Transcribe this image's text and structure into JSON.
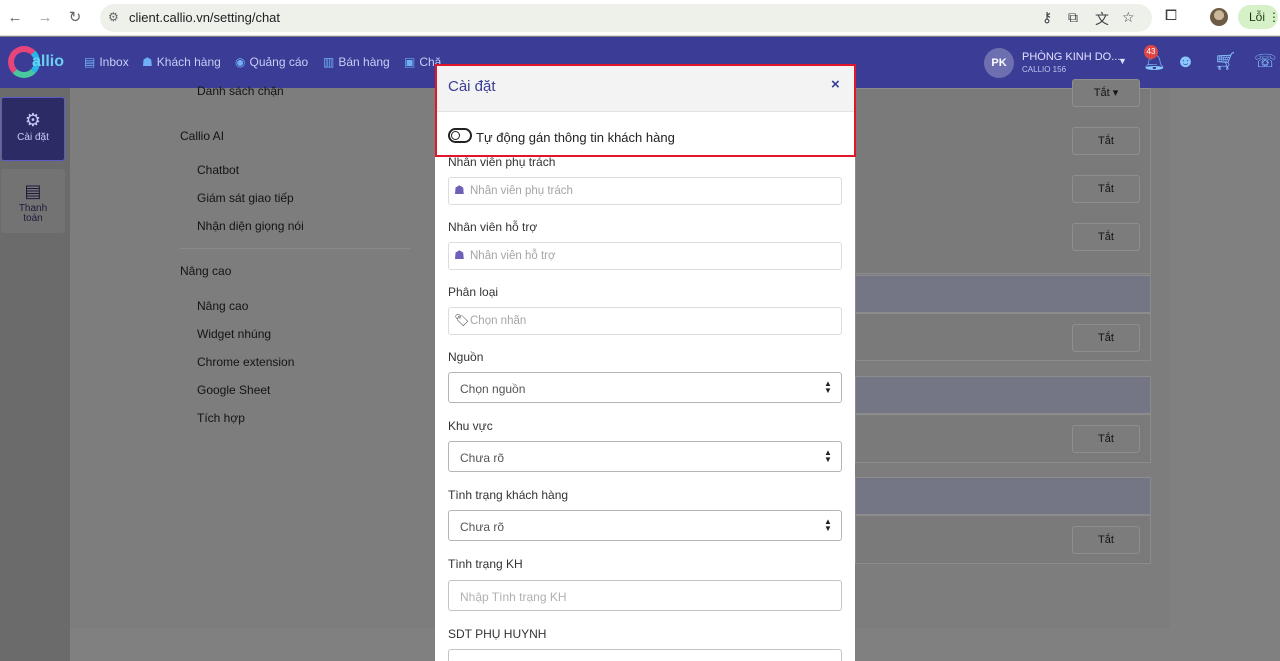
{
  "browser": {
    "url": "client.callio.vn/setting/chat",
    "error_label": "Lỗi",
    "icons": [
      "back-icon",
      "forward-icon",
      "reload-icon",
      "site-info-icon",
      "password-key-icon",
      "install-app-icon",
      "translate-icon",
      "bookmark-star-icon",
      "extensions-icon",
      "profile-avatar",
      "more-menu-icon"
    ]
  },
  "header": {
    "logo_text": "allio",
    "nav": [
      {
        "label": "Inbox",
        "icon": "inbox-icon"
      },
      {
        "label": "Khách hàng",
        "icon": "customers-icon"
      },
      {
        "label": "Quảng cáo",
        "icon": "ads-icon"
      },
      {
        "label": "Bán hàng",
        "icon": "sales-icon"
      },
      {
        "label": "Chă",
        "icon": "care-icon"
      }
    ],
    "user": {
      "initials": "PK",
      "name": "PHÒNG KINH DO...",
      "sub": "CALLIO 156"
    },
    "notification_count": "43",
    "colors": {
      "header_bg": "#3a3c96",
      "accent": "#3a3c96",
      "highlight": "#e0162b"
    }
  },
  "leftbar": {
    "items": [
      {
        "label": "Cài đặt",
        "icon": "gear-icon",
        "active": true
      },
      {
        "label": "Thanh toán",
        "icon": "receipt-icon",
        "active": false
      }
    ]
  },
  "settings_menu": {
    "top_partial": "Danh sách chặn",
    "groups": [
      {
        "title": "Callio AI",
        "items": [
          "Chatbot",
          "Giám sát giao tiếp",
          "Nhận diện giọng nói"
        ]
      },
      {
        "title": "Nâng cao",
        "items": [
          "Nâng cao",
          "Widget nhúng",
          "Chrome extension",
          "Google Sheet",
          "Tích hợp"
        ]
      }
    ]
  },
  "right_buttons": {
    "dropdown_label": "Tắt",
    "off_label": "Tắt"
  },
  "modal": {
    "title": "Cài đặt",
    "close": "×",
    "toggle_label": "Tự động gán thông tin khách hàng",
    "toggle_on": false,
    "fields": {
      "staff_in_charge": {
        "label": "Nhân viên phụ trách",
        "placeholder": "Nhân viên phụ trách"
      },
      "support_staff": {
        "label": "Nhân viên hỗ trợ",
        "placeholder": "Nhân viên hỗ trợ"
      },
      "category": {
        "label": "Phân loại",
        "placeholder": "Chọn nhãn"
      },
      "source": {
        "label": "Nguồn",
        "value": "Chọn nguồn"
      },
      "region": {
        "label": "Khu vực",
        "value": "Chưa rõ"
      },
      "customer_status": {
        "label": "Tình trạng khách hàng",
        "value": "Chưa rõ"
      },
      "status_kh": {
        "label": "Tình trạng KH",
        "placeholder": "Nhập Tình trạng KH"
      },
      "parent_phone": {
        "label": "SDT PHỤ HUYNH"
      }
    }
  }
}
